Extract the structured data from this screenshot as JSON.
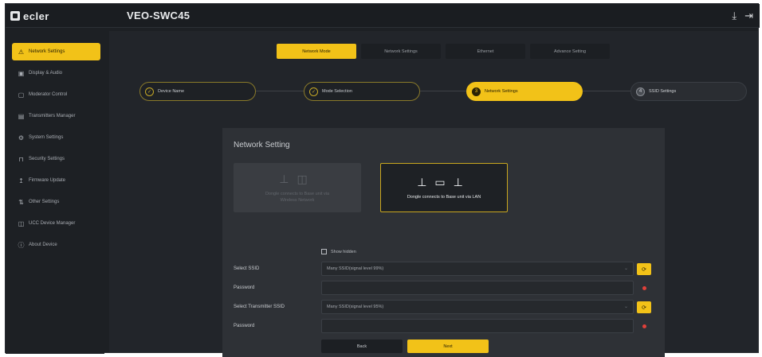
{
  "header": {
    "logo_text": "ecler",
    "device_name": "VEO-SWC45",
    "icons": [
      "download-icon",
      "logout-icon"
    ]
  },
  "sidebar": {
    "items": [
      {
        "label": "Network Settings",
        "icon": "network-icon",
        "active": true
      },
      {
        "label": "Display & Audio",
        "icon": "display-icon",
        "active": false
      },
      {
        "label": "Moderator Control",
        "icon": "moderator-icon",
        "active": false
      },
      {
        "label": "Transmitters Manager",
        "icon": "transmitter-icon",
        "active": false
      },
      {
        "label": "System Settings",
        "icon": "gear-icon",
        "active": false
      },
      {
        "label": "Security Settings",
        "icon": "lock-icon",
        "active": false
      },
      {
        "label": "Firmware Update",
        "icon": "update-icon",
        "active": false
      },
      {
        "label": "Other Settings",
        "icon": "sliders-icon",
        "active": false
      },
      {
        "label": "UCC Device Manager",
        "icon": "device-icon",
        "active": false
      },
      {
        "label": "About Device",
        "icon": "info-icon",
        "active": false
      }
    ]
  },
  "tabs": [
    {
      "label": "Network Mode",
      "active": true
    },
    {
      "label": "Network Settings",
      "active": false
    },
    {
      "label": "Ethernet",
      "active": false
    },
    {
      "label": "Advance Setting",
      "active": false
    }
  ],
  "steps": [
    {
      "label": "Device Name",
      "state": "done"
    },
    {
      "label": "Mode Selection",
      "state": "done"
    },
    {
      "label": "Network Settings",
      "state": "active",
      "marker": "3"
    },
    {
      "label": "SSID Settings",
      "state": "pending",
      "marker": "4"
    }
  ],
  "form": {
    "title": "Network Setting",
    "option_dim_text": "Dongle connects to Base unit via Wireless Network",
    "option_selected_text": "Dongle connects to Base unit via LAN",
    "checkbox_label": "Show hidden",
    "ssid_label": "Select SSID",
    "ssid_value": "Many SSID(signal level 99%)",
    "password_label": "Password",
    "transmitter_ssid_label": "Select Transmitter SSID",
    "transmitter_ssid_value": "Many SSID(signal level 95%)",
    "password2_label": "Password",
    "back_label": "Back",
    "next_label": "Next"
  },
  "colors": {
    "accent": "#f2c218",
    "background": "#1d2024",
    "panel": "#2e3136",
    "required": "#e0403a"
  }
}
